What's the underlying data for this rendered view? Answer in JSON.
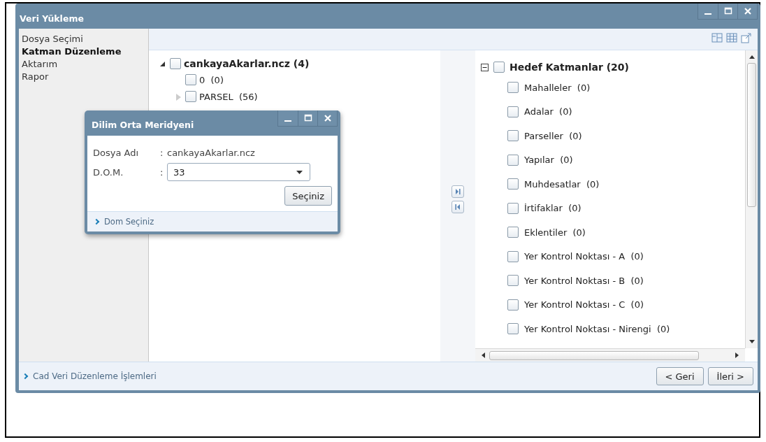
{
  "window": {
    "title": "Veri Yükleme"
  },
  "sidebar": {
    "items": [
      {
        "label": "Dosya Seçimi",
        "selected": false
      },
      {
        "label": "Katman Düzenleme",
        "selected": true
      },
      {
        "label": "Aktarım",
        "selected": false
      },
      {
        "label": "Rapor",
        "selected": false
      }
    ]
  },
  "source_tree": [
    {
      "label": "cankayaAkarlar.ncz (4)",
      "checked": false,
      "expanded": true,
      "children": [
        {
          "label": "0  (0)",
          "checked": false
        },
        {
          "label": "PARSEL  (56)",
          "checked": false,
          "expanded": false
        }
      ]
    }
  ],
  "target_tree": {
    "label": "Hedef Katmanlar (20)",
    "checked": false,
    "expanded": true,
    "children": [
      {
        "label": "Mahalleler  (0)",
        "checked": false
      },
      {
        "label": "Adalar  (0)",
        "checked": false
      },
      {
        "label": "Parseller  (0)",
        "checked": false
      },
      {
        "label": "Yapılar  (0)",
        "checked": false
      },
      {
        "label": "Muhdesatlar  (0)",
        "checked": false
      },
      {
        "label": "İrtifaklar  (0)",
        "checked": false
      },
      {
        "label": "Eklentiler  (0)",
        "checked": false
      },
      {
        "label": "Yer Kontrol Noktası - A  (0)",
        "checked": false
      },
      {
        "label": "Yer Kontrol Noktası - B  (0)",
        "checked": false
      },
      {
        "label": "Yer Kontrol Noktası - C  (0)",
        "checked": false
      },
      {
        "label": "Yer Kontrol Noktası - Nirengi  (0)",
        "checked": false
      }
    ]
  },
  "footer": {
    "link": "Cad Veri Düzenleme İşlemleri",
    "buttons": [
      "< Geri",
      "İleri >"
    ]
  },
  "dialog": {
    "title": "Dilim Orta Meridyeni",
    "fields": [
      {
        "kind": "text",
        "label": "Dosya Adı",
        "separator": ":",
        "value": "cankayaAkarlar.ncz"
      },
      {
        "kind": "select",
        "label": "D.O.M.",
        "separator": ":",
        "value": "33"
      }
    ],
    "button": "Seçiniz",
    "footer_link": "Dom Seçiniz"
  }
}
